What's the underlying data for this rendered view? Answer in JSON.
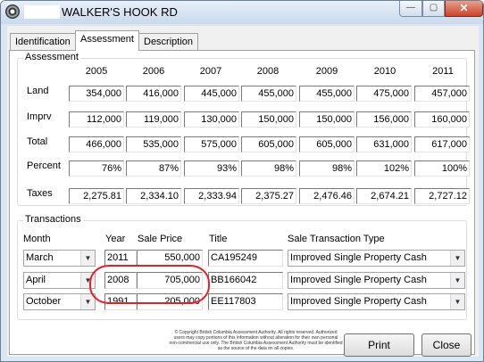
{
  "window": {
    "title": "WALKER'S HOOK RD",
    "min_label": "—",
    "max_label": "▢",
    "close_label": "✕"
  },
  "tabs": [
    {
      "label": "Identification",
      "active": false
    },
    {
      "label": "Assessment",
      "active": true
    },
    {
      "label": "Description",
      "active": false
    }
  ],
  "assessment": {
    "group_label": "Assessment",
    "years": [
      "2005",
      "2006",
      "2007",
      "2008",
      "2009",
      "2010",
      "2011"
    ],
    "rows": [
      {
        "label": "Land",
        "values": [
          "354,000",
          "416,000",
          "445,000",
          "455,000",
          "455,000",
          "475,000",
          "457,000"
        ]
      },
      {
        "label": "Imprv",
        "values": [
          "112,000",
          "119,000",
          "130,000",
          "150,000",
          "150,000",
          "156,000",
          "160,000"
        ]
      },
      {
        "label": "Total",
        "values": [
          "466,000",
          "535,000",
          "575,000",
          "605,000",
          "605,000",
          "631,000",
          "617,000"
        ]
      },
      {
        "label": "Percent",
        "values": [
          "76%",
          "87%",
          "93%",
          "98%",
          "98%",
          "102%",
          "100%"
        ]
      },
      {
        "label": "Taxes",
        "values": [
          "2,275.81",
          "2,334.10",
          "2,333.94",
          "2,375.27",
          "2,476.46",
          "2,674.21",
          "2,727.12"
        ]
      }
    ]
  },
  "transactions": {
    "group_label": "Transactions",
    "headers": {
      "month": "Month",
      "year": "Year",
      "sale_price": "Sale Price",
      "title": "Title",
      "type": "Sale Transaction Type"
    },
    "rows": [
      {
        "month": "March",
        "year": "2011",
        "sale_price": "550,000",
        "title": "CA195249",
        "type": "Improved Single Property Cash"
      },
      {
        "month": "April",
        "year": "2008",
        "sale_price": "705,000",
        "title": "BB166042",
        "type": "Improved Single Property Cash"
      },
      {
        "month": "October",
        "year": "1991",
        "sale_price": "205,000",
        "title": "EE117803",
        "type": "Improved Single Property Cash"
      }
    ]
  },
  "copyright": "© Copyright British Columbia Assessment Authority. All rights reserved. Authorized users may copy portions of this information without alteration for their own personal non-commercial use only. The British Columbia Assessment Authority must be identified as the source of the data on all copies.",
  "buttons": {
    "print": "Print",
    "close": "Close"
  },
  "colors": {
    "annotation": "#e0202a",
    "window_frame": "#dbe6f3"
  }
}
